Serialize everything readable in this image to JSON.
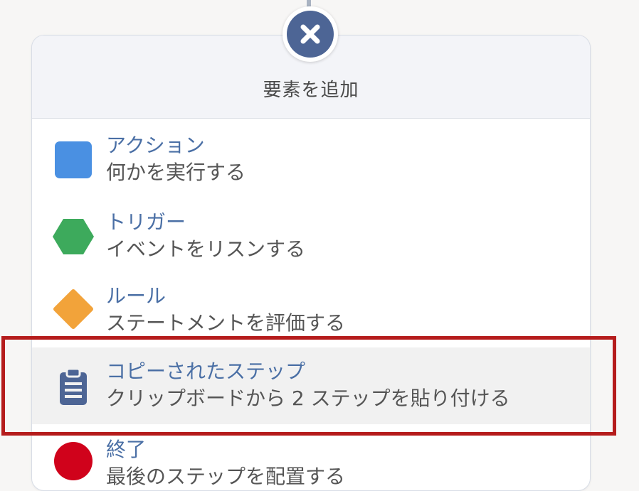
{
  "panel": {
    "title": "要素を追加"
  },
  "items": [
    {
      "title": "アクション",
      "description": "何かを実行する",
      "icon": "blue-square-icon",
      "color": "#4a90e2"
    },
    {
      "title": "トリガー",
      "description": "イベントをリスンする",
      "icon": "green-hexagon-icon",
      "color": "#3daa5c"
    },
    {
      "title": "ルール",
      "description": "ステートメントを評価する",
      "icon": "orange-diamond-icon",
      "color": "#f2a33a"
    },
    {
      "title": "コピーされたステップ",
      "description": "クリップボードから 2 ステップを貼り付ける",
      "icon": "clipboard-icon",
      "color": "#4d6595",
      "highlighted": true
    },
    {
      "title": "終了",
      "description": "最後のステップを配置する",
      "icon": "red-circle-icon",
      "color": "#d0021b"
    }
  ],
  "colors": {
    "accent": "#4d6595",
    "highlight_border": "#b51c1c"
  }
}
